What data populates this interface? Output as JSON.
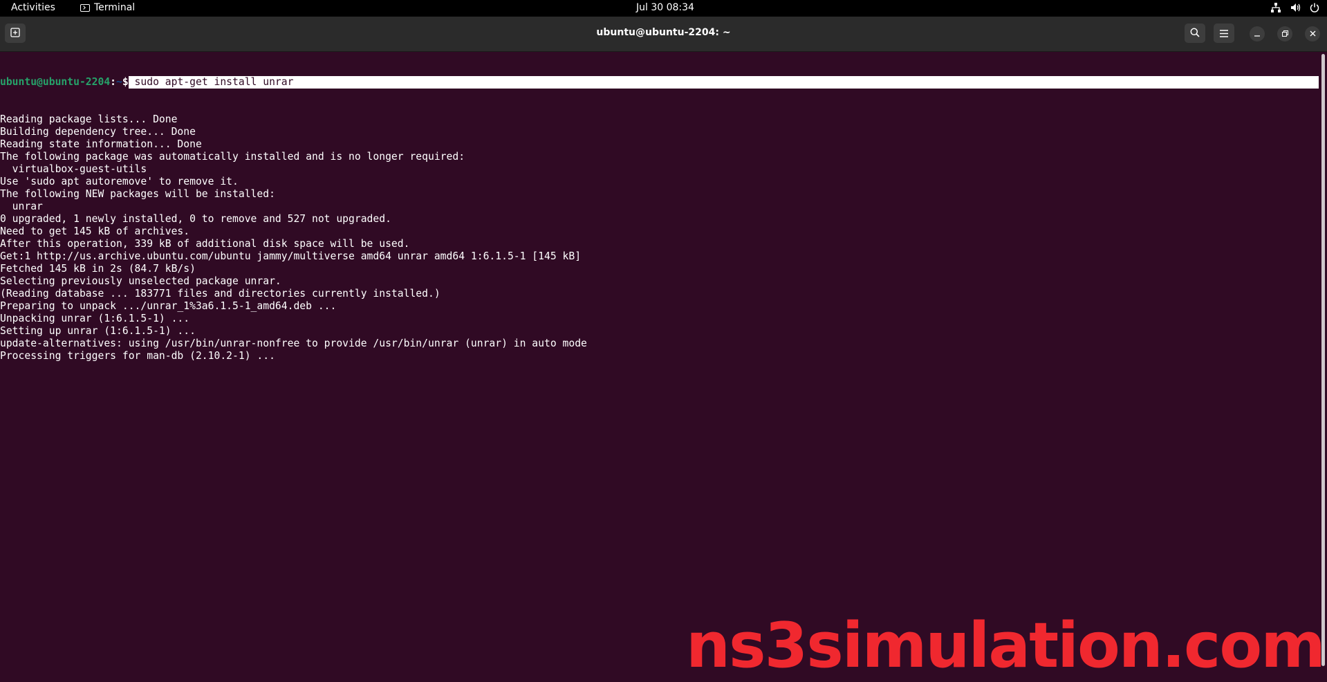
{
  "topbar": {
    "activities": "Activities",
    "app_name": "Terminal",
    "clock": "Jul 30  08:34",
    "icons": [
      "network-icon",
      "volume-icon",
      "power-icon"
    ]
  },
  "window": {
    "title": "ubuntu@ubuntu-2204: ~",
    "icons": [
      "new-tab-icon",
      "search-icon",
      "menu-icon",
      "minimize-icon",
      "restore-icon",
      "close-icon"
    ]
  },
  "terminal": {
    "prompt_user": "ubuntu@ubuntu-2204",
    "prompt_sep": ":",
    "prompt_path": "~",
    "prompt_dollar": "$",
    "command": " sudo apt-get install unrar",
    "output": [
      "Reading package lists... Done",
      "Building dependency tree... Done",
      "Reading state information... Done",
      "The following package was automatically installed and is no longer required:",
      "  virtualbox-guest-utils",
      "Use 'sudo apt autoremove' to remove it.",
      "The following NEW packages will be installed:",
      "  unrar",
      "0 upgraded, 1 newly installed, 0 to remove and 527 not upgraded.",
      "Need to get 145 kB of archives.",
      "After this operation, 339 kB of additional disk space will be used.",
      "Get:1 http://us.archive.ubuntu.com/ubuntu jammy/multiverse amd64 unrar amd64 1:6.1.5-1 [145 kB]",
      "Fetched 145 kB in 2s (84.7 kB/s)",
      "Selecting previously unselected package unrar.",
      "(Reading database ... 183771 files and directories currently installed.)",
      "Preparing to unpack .../unrar_1%3a6.1.5-1_amd64.deb ...",
      "Unpacking unrar (1:6.1.5-1) ...",
      "Setting up unrar (1:6.1.5-1) ...",
      "update-alternatives: using /usr/bin/unrar-nonfree to provide /usr/bin/unrar (unrar) in auto mode",
      "Processing triggers for man-db (2.10.2-1) ..."
    ]
  },
  "watermark": "ns3simulation.com",
  "colors": {
    "terminal_bg": "#300a24",
    "prompt_user": "#26a269",
    "prompt_path": "#12488b",
    "watermark": "#f0282f"
  }
}
